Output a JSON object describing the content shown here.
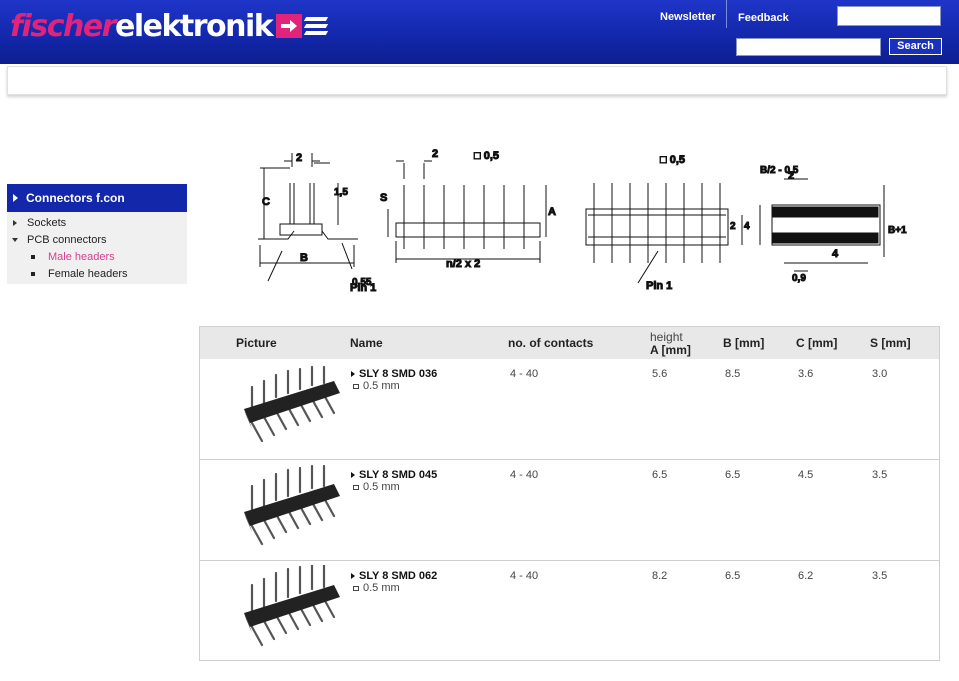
{
  "header": {
    "logo_part1": "fischer",
    "logo_part2": "elektronik",
    "links": {
      "newsletter": "Newsletter",
      "feedback": "Feedback"
    },
    "search": {
      "button_label": "Search",
      "value": "",
      "placeholder": ""
    },
    "login_value": ""
  },
  "colors": {
    "brand_blue": "#1227a9",
    "brand_pink": "#e2237b",
    "active_link": "#d6408f"
  },
  "sidebar": {
    "title": "Connectors f.con",
    "items": [
      {
        "label": "Sockets",
        "icon": "arrow-right-icon"
      },
      {
        "label": "PCB connectors",
        "icon": "arrow-down-icon"
      },
      {
        "label": "Male headers",
        "icon": "square-bullet-icon",
        "active": true
      },
      {
        "label": "Female headers",
        "icon": "square-bullet-icon"
      }
    ]
  },
  "drawing": {
    "labels": {
      "two": "2",
      "c": "C",
      "one_five": "1,5",
      "b": "B",
      "pin1": "Pin 1",
      "zero_five_five": "0,55",
      "s": "S",
      "sq05": "□ 0,5",
      "a": "A",
      "n2x2": "n/2 x 2",
      "four": "4",
      "b2_05": "B/2 - 0,5",
      "b_plus_1": "B+1",
      "zero_nine": "0,9"
    }
  },
  "table": {
    "headers": {
      "picture": "Picture",
      "name": "Name",
      "contacts": "no. of contacts",
      "height_top": "height",
      "height_bottom": "A [mm]",
      "b": "B [mm]",
      "c": "C [mm]",
      "s": "S [mm]"
    },
    "rows": [
      {
        "name": "SLY 8 SMD 036",
        "desc": "0.5 mm",
        "contacts": "4 - 40",
        "a": "5.6",
        "b": "8.5",
        "c": "3.6",
        "s": "3.0"
      },
      {
        "name": "SLY 8 SMD 045",
        "desc": "0.5 mm",
        "contacts": "4 - 40",
        "a": "6.5",
        "b": "6.5",
        "c": "4.5",
        "s": "3.5"
      },
      {
        "name": "SLY 8 SMD 062",
        "desc": "0.5 mm",
        "contacts": "4 - 40",
        "a": "8.2",
        "b": "6.5",
        "c": "6.2",
        "s": "3.5"
      }
    ]
  }
}
